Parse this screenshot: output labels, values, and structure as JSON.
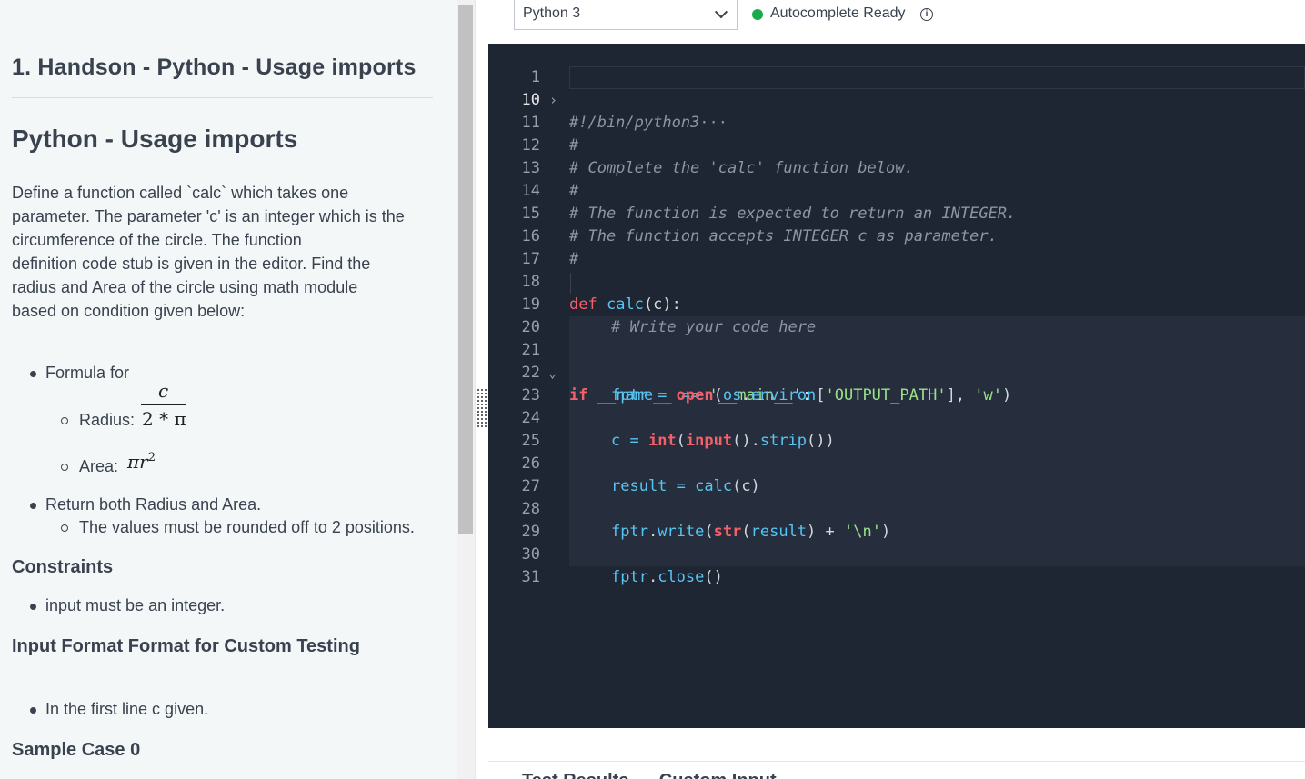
{
  "problem": {
    "title": "1. Handson - Python - Usage imports",
    "heading": "Python - Usage imports",
    "description": "Define a function called `calc` which takes one\nparameter. The parameter 'c' is an integer which is the\ncircumference of the circle. The function\ndefinition code stub is given in the editor. Find the\nradius and Area of the circle using math module\nbased on condition given below:",
    "formula_label": "Formula for",
    "radius_label": "Radius:",
    "radius_numerator": "c",
    "radius_denominator": "2 * π",
    "area_label": "Area:",
    "area_formula": "πr",
    "area_exponent": "2",
    "return_text": "Return both Radius and Area.",
    "rounding_text": "The values must be rounded off to 2 positions.",
    "constraints_heading": "Constraints",
    "constraint_item": "input must be an integer.",
    "input_format_heading": "Input Format Format for Custom Testing",
    "input_format_item": "In the first line c given.",
    "sample_heading": "Sample Case 0"
  },
  "editor": {
    "language": "Python 3",
    "status": "Autocomplete Ready",
    "status_color": "#1ba94c",
    "info_icon": "info-icon",
    "line_numbers": [
      "1",
      "10",
      "11",
      "12",
      "13",
      "14",
      "15",
      "16",
      "17",
      "18",
      "19",
      "20",
      "21",
      "22",
      "23",
      "24",
      "25",
      "26",
      "27",
      "28",
      "29",
      "30",
      "31"
    ],
    "shebang": "#!/bin/python3",
    "ellipsis": "···",
    "comments": {
      "hash": "#",
      "complete": "# Complete the 'calc' function below.",
      "returns": "# The function is expected to return an INTEGER.",
      "accepts": "# The function accepts INTEGER c as parameter.",
      "write": "# Write your code here"
    },
    "tokens": {
      "def": "def",
      "calc": "calc",
      "calc_sig": "(c):",
      "if": "if",
      "name_check": " __name__ == ",
      "main_str": "'__main__'",
      "colon": ":",
      "fptr_assign": "fptr = ",
      "open": "open",
      "lparen": "(",
      "os": "os",
      "dot": ".",
      "environ": "environ",
      "lbracket": "[",
      "output_path": "'OUTPUT_PATH'",
      "rbracket_comma": "], ",
      "w_str": "'w'",
      "rparen": ")",
      "c_assign": "c = ",
      "int": "int",
      "input": "input",
      "paren_pair": "()",
      "strip": "strip",
      "close_parens": "())",
      "result_assign": "result = ",
      "c_arg": "(c)",
      "fptr": "fptr",
      "write": "write",
      "str": "str",
      "result": "result",
      "plus": ") + ",
      "newline_str": "'\\n'",
      "close": "close"
    }
  },
  "bottom": {
    "tabs_text": "Test Results      Custom Input"
  }
}
